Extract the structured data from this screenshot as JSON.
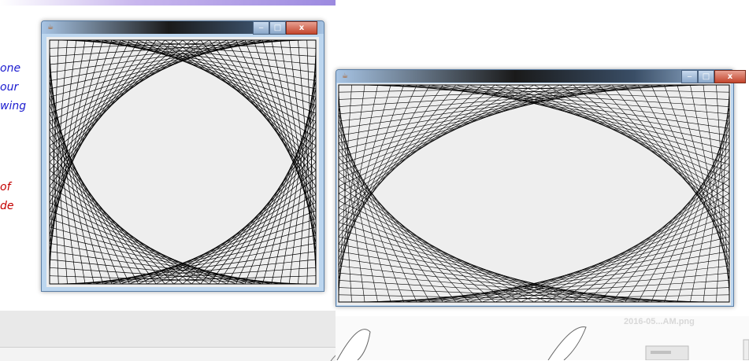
{
  "slide": {
    "text_lines": [
      {
        "text": "one",
        "color": "#1a1acf"
      },
      {
        "text": "our",
        "color": "#1a1acf"
      },
      {
        "text": "wing",
        "color": "#1a1acf"
      },
      {
        "text": "of",
        "color": "#c40000"
      },
      {
        "text": "de",
        "color": "#c40000"
      }
    ]
  },
  "desktop": {
    "file_label": "2016-05...AM.png"
  },
  "window_left": {
    "icon": "java-cup-icon",
    "buttons": {
      "minimize": "‒",
      "maximize": "□",
      "close": "x"
    },
    "drawing": {
      "pattern": "string-art-square",
      "lines_per_side": 30,
      "stroke": "#000000"
    }
  },
  "window_right": {
    "icon": "java-cup-icon",
    "buttons": {
      "minimize": "‒",
      "maximize": "□",
      "close": "x"
    },
    "drawing": {
      "pattern": "string-art-rectangle",
      "lines_per_side": 30,
      "stroke": "#000000"
    }
  }
}
